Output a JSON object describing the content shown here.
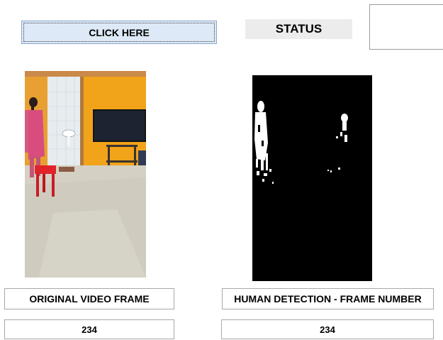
{
  "controls": {
    "click_button_label": "CLICK HERE",
    "status_label": "STATUS",
    "status_value": ""
  },
  "panels": {
    "original": {
      "title": "ORIGINAL VIDEO FRAME",
      "frame_number": "234"
    },
    "detection": {
      "title": "HUMAN DETECTION -  FRAME NUMBER",
      "frame_number": "234"
    }
  },
  "colors": {
    "button_bg": "#dde9f7",
    "status_bg": "#ececec",
    "wall": "#f1a31a",
    "chair": "#e0242a",
    "mask_bg": "#000000",
    "mask_fg": "#ffffff"
  }
}
